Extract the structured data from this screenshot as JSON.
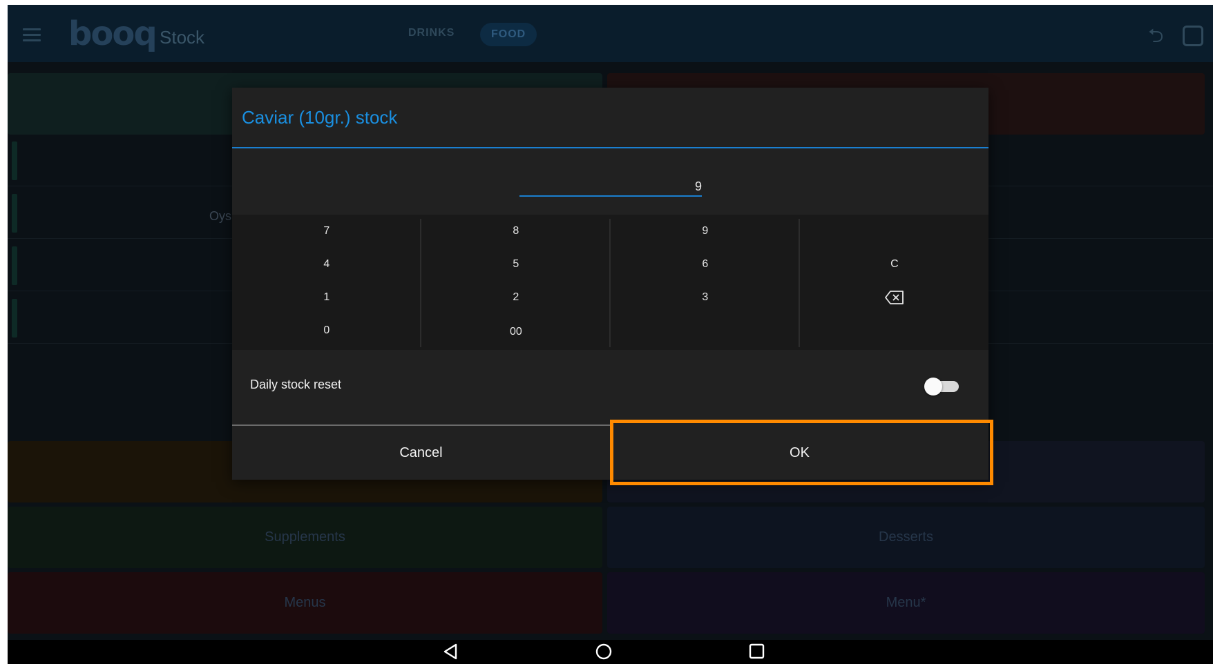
{
  "app": {
    "logo_text": "booq",
    "title": "Stock",
    "tabs": [
      {
        "label": "DRINKS",
        "active": false
      },
      {
        "label": "FOOD",
        "active": true
      }
    ]
  },
  "background": {
    "peek_text": "Oys",
    "tiles": [
      "Supplements",
      "Desserts",
      "Menus",
      "Menu*"
    ]
  },
  "dialog": {
    "title": "Caviar (10gr.) stock",
    "value": "9",
    "keypad": {
      "row1": [
        "7",
        "8",
        "9",
        ""
      ],
      "row2": [
        "4",
        "5",
        "6",
        "C"
      ],
      "row3": [
        "1",
        "2",
        "3",
        ""
      ],
      "row4": [
        "0",
        "00",
        "",
        ""
      ]
    },
    "backspace_icon": "backspace-icon",
    "daily_reset_label": "Daily stock reset",
    "daily_reset_on": false,
    "cancel_label": "Cancel",
    "ok_label": "OK"
  },
  "colors": {
    "accent": "#1a8fe0",
    "highlight": "#ff8a00",
    "dialog_bg": "#212121"
  }
}
